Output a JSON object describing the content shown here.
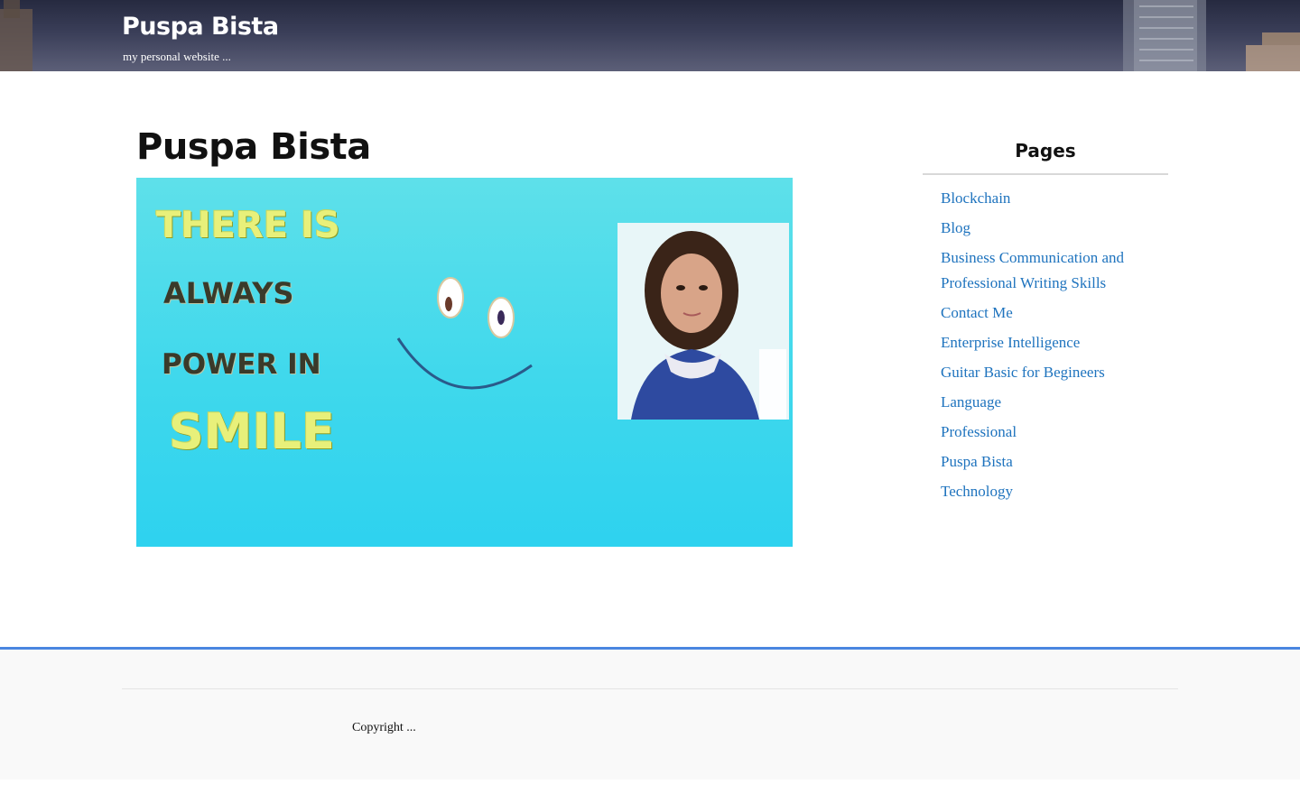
{
  "header": {
    "site_title": "Puspa Bista",
    "site_description": "my personal website ..."
  },
  "main": {
    "page_title": "Puspa Bista",
    "featured_image": {
      "text_lines": [
        "THERE IS",
        "ALWAYS",
        "POWER IN",
        "SMILE"
      ]
    }
  },
  "sidebar": {
    "widget_title": "Pages",
    "pages": [
      "Blockchain",
      "Blog",
      "Business Communication and Professional Writing Skills",
      "Contact Me",
      "Enterprise Intelligence",
      "Guitar Basic for Begineers",
      "Language",
      "Professional",
      "Puspa Bista",
      "Technology"
    ]
  },
  "footer": {
    "copyright": "Copyright ..."
  },
  "colors": {
    "link": "#1e73be",
    "footer_accent": "#4a86e0",
    "header_bg": "#2f3350"
  }
}
